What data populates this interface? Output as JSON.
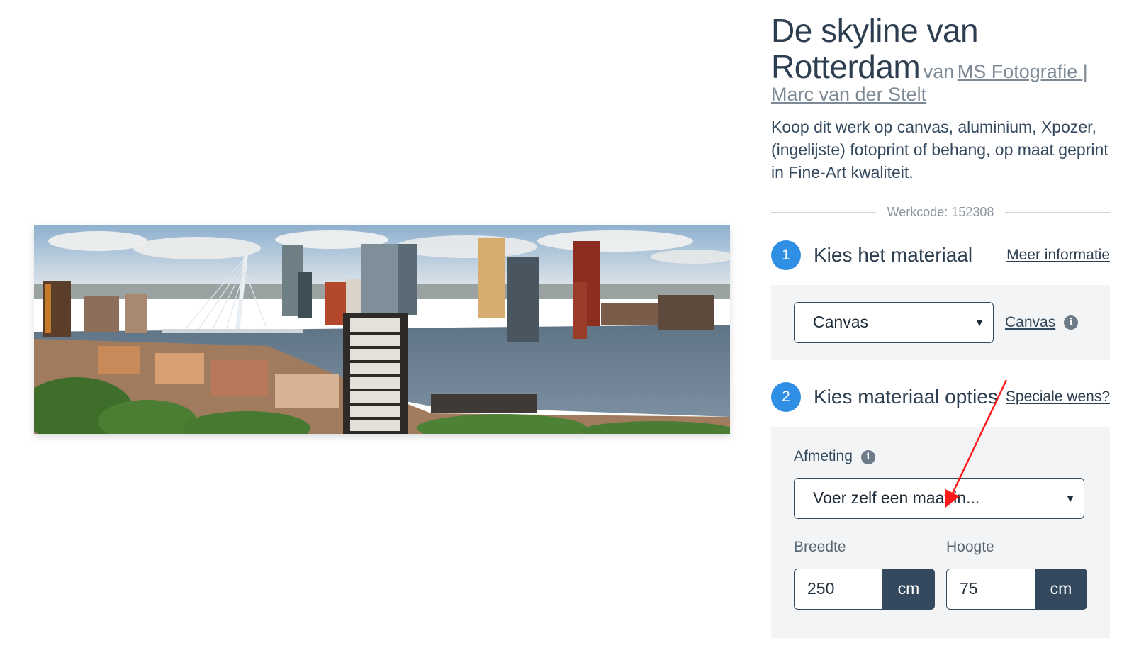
{
  "artwork": {
    "image_alt": "Panorama skyline of Rotterdam with the Erasmus bridge over the Maas river"
  },
  "product": {
    "title": "De skyline van Rotterdam",
    "by": "van",
    "artist_line1": "MS Fotografie |",
    "artist_line2": "Marc van der Stelt",
    "description": "Koop dit werk op canvas, aluminium, Xpozer, (ingelijste) fotoprint of behang, op maat geprint in Fine-Art kwaliteit.",
    "workcode": "Werkcode: 152308"
  },
  "step1": {
    "number": "1",
    "title": "Kies het materiaal",
    "link": "Meer informatie",
    "material_select": "Canvas",
    "material_link": "Canvas"
  },
  "step2": {
    "number": "2",
    "title": "Kies materiaal opties",
    "link": "Speciale wens?",
    "size_label": "Afmeting",
    "size_select": "Voer zelf een maat in...",
    "width_label": "Breedte",
    "width_value": "250",
    "width_unit": "cm",
    "height_label": "Hoogte",
    "height_value": "75",
    "height_unit": "cm"
  },
  "colors": {
    "accent": "#2f8fe4",
    "dark": "#34495e",
    "annotation": "#ff1a1a"
  },
  "icons": {
    "info": "i",
    "chevron": "⌄"
  }
}
